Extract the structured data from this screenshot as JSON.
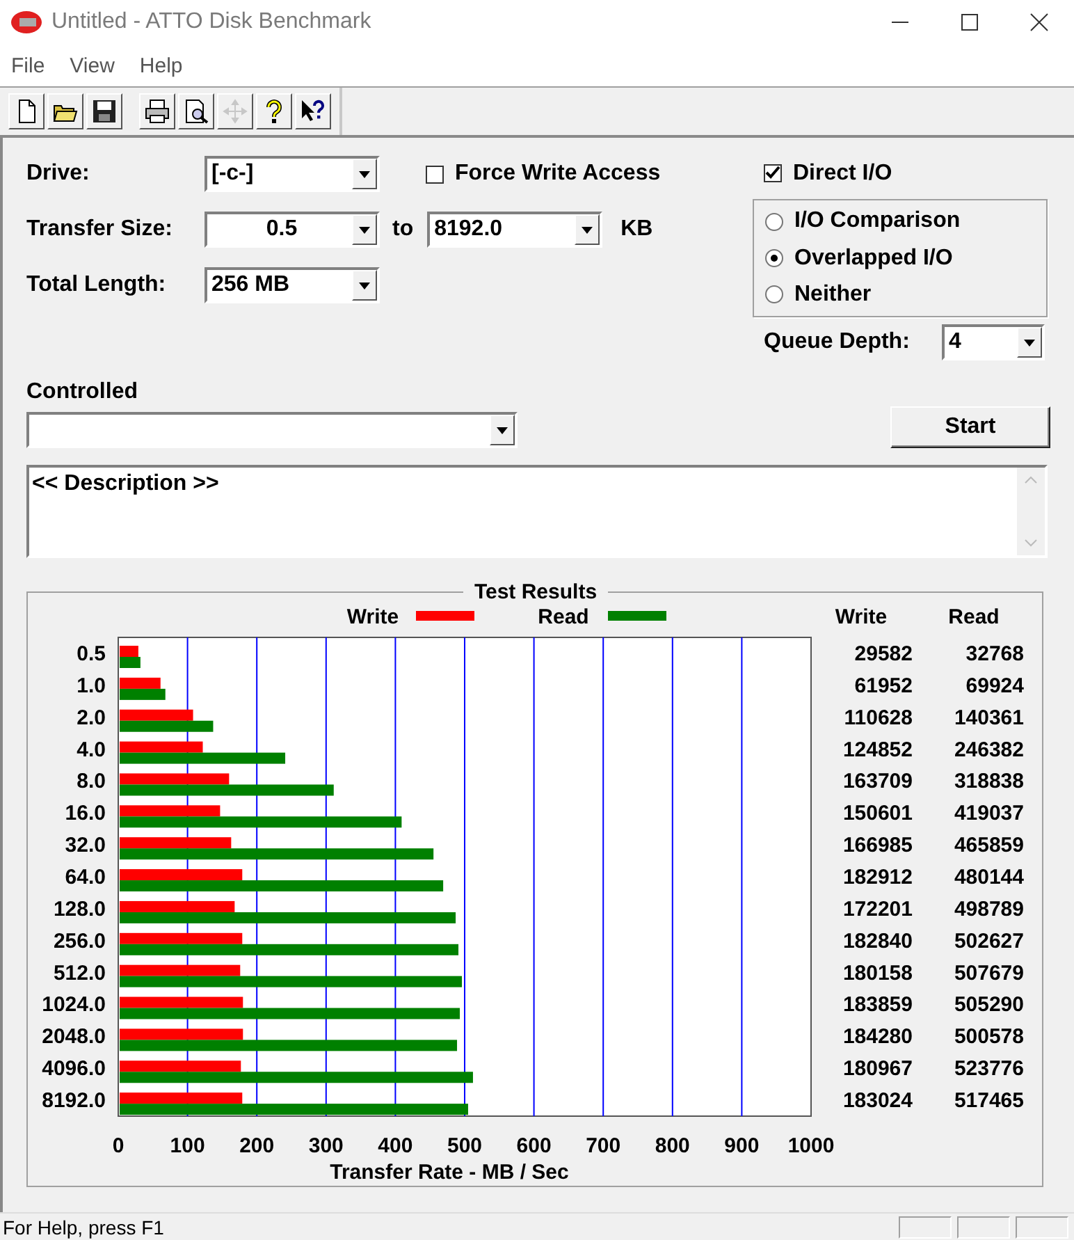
{
  "window": {
    "title": "Untitled - ATTO Disk Benchmark"
  },
  "menu": [
    "File",
    "View",
    "Help"
  ],
  "toolbar": [
    {
      "kind": "new",
      "disabled": false
    },
    {
      "kind": "open",
      "disabled": false
    },
    {
      "kind": "save",
      "disabled": false
    },
    {
      "kind": "separator"
    },
    {
      "kind": "print",
      "disabled": false
    },
    {
      "kind": "preview",
      "disabled": false
    },
    {
      "kind": "move",
      "disabled": true
    },
    {
      "kind": "help",
      "disabled": false
    },
    {
      "kind": "context-help",
      "disabled": false
    }
  ],
  "form": {
    "drive": {
      "label": "Drive:",
      "value": "[-c-]"
    },
    "force_write_access": {
      "label": "Force Write Access",
      "checked": false
    },
    "transfer_size": {
      "label": "Transfer Size:",
      "from": "0.5",
      "joiner": "to",
      "to": "8192.0",
      "unit": "KB"
    },
    "total_length": {
      "label": "Total Length:",
      "value": "256 MB"
    },
    "direct_io": {
      "label": "Direct I/O",
      "checked": true
    },
    "io_modes": [
      {
        "label": "I/O Comparison",
        "selected": false
      },
      {
        "label": "Overlapped I/O",
        "selected": true
      },
      {
        "label": "Neither",
        "selected": false
      }
    ],
    "queue_depth": {
      "label": "Queue Depth:",
      "value": "4"
    },
    "controlled": {
      "label": "Controlled"
    },
    "start_button": "Start",
    "description": "<< Description >>"
  },
  "results": {
    "title": "Test Results",
    "columns": [
      "Write",
      "Read"
    ],
    "rows": [
      {
        "write": "29582",
        "read": "32768"
      },
      {
        "write": "61952",
        "read": "69924"
      },
      {
        "write": "110628",
        "read": "140361"
      },
      {
        "write": "124852",
        "read": "246382"
      },
      {
        "write": "163709",
        "read": "318838"
      },
      {
        "write": "150601",
        "read": "419037"
      },
      {
        "write": "166985",
        "read": "465859"
      },
      {
        "write": "182912",
        "read": "480144"
      },
      {
        "write": "172201",
        "read": "498789"
      },
      {
        "write": "182840",
        "read": "502627"
      },
      {
        "write": "180158",
        "read": "507679"
      },
      {
        "write": "183859",
        "read": "505290"
      },
      {
        "write": "184280",
        "read": "500578"
      },
      {
        "write": "180967",
        "read": "523776"
      },
      {
        "write": "183024",
        "read": "517465"
      }
    ],
    "chart_data": {
      "type": "bar",
      "orientation": "horizontal",
      "xlabel": "Transfer Rate - MB / Sec",
      "categories": [
        "0.5",
        "1.0",
        "2.0",
        "4.0",
        "8.0",
        "16.0",
        "32.0",
        "64.0",
        "128.0",
        "256.0",
        "512.0",
        "1024.0",
        "2048.0",
        "4096.0",
        "8192.0"
      ],
      "series": [
        {
          "name": "Write",
          "color": "#ff0000",
          "values": [
            29,
            61,
            108,
            122,
            160,
            147,
            163,
            179,
            168,
            179,
            176,
            180,
            180,
            177,
            179
          ]
        },
        {
          "name": "Read",
          "color": "#008000",
          "values": [
            32,
            68,
            137,
            241,
            311,
            409,
            455,
            469,
            487,
            491,
            496,
            493,
            489,
            512,
            505
          ]
        }
      ],
      "grid": true,
      "legend": true,
      "xlim": [
        0,
        1000
      ],
      "xticks": [
        0,
        100,
        200,
        300,
        400,
        500,
        600,
        700,
        800,
        900,
        1000
      ]
    }
  },
  "status_bar": {
    "text": "For Help, press F1"
  }
}
